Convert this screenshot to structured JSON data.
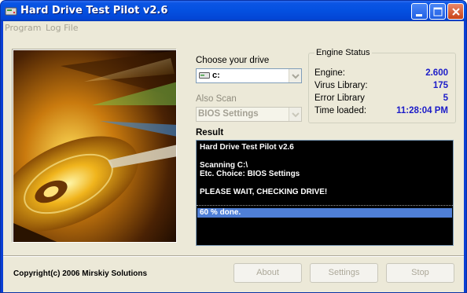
{
  "window": {
    "title": "Hard Drive Test Pilot v2.6",
    "colors": {
      "titlebar": "#0450e0",
      "client": "#ece9d8",
      "value_blue": "#1b1bc8"
    }
  },
  "menu": {
    "items": [
      {
        "label": "Program",
        "enabled": false
      },
      {
        "label": "Log File",
        "enabled": false
      }
    ]
  },
  "drive": {
    "label": "Choose your drive",
    "selected": "c:",
    "icon": "drive-icon"
  },
  "also_scan": {
    "label": "Also Scan",
    "selected": "BIOS Settings",
    "enabled": false
  },
  "engine_status": {
    "title": "Engine Status",
    "rows": [
      {
        "label": "Engine:",
        "value": "2.600"
      },
      {
        "label": "Virus Library:",
        "value": "175"
      },
      {
        "label": "Error Library",
        "value": "5"
      },
      {
        "label": "Time loaded:",
        "value": "11:28:04 PM"
      }
    ]
  },
  "result": {
    "label": "Result",
    "lines": [
      "Hard Drive Test Pilot v2.6",
      "",
      "Scanning C:\\",
      "Etc. Choice: BIOS Settings",
      "",
      "PLEASE WAIT, CHECKING DRIVE!"
    ],
    "progress_text": "60 % done.",
    "progress_percent": 60
  },
  "footer": {
    "copyright": "Copyright(c) 2006 Mirskiy Solutions",
    "buttons": [
      {
        "label": "About",
        "enabled": false
      },
      {
        "label": "Settings",
        "enabled": false
      },
      {
        "label": "Stop",
        "enabled": false
      }
    ]
  }
}
